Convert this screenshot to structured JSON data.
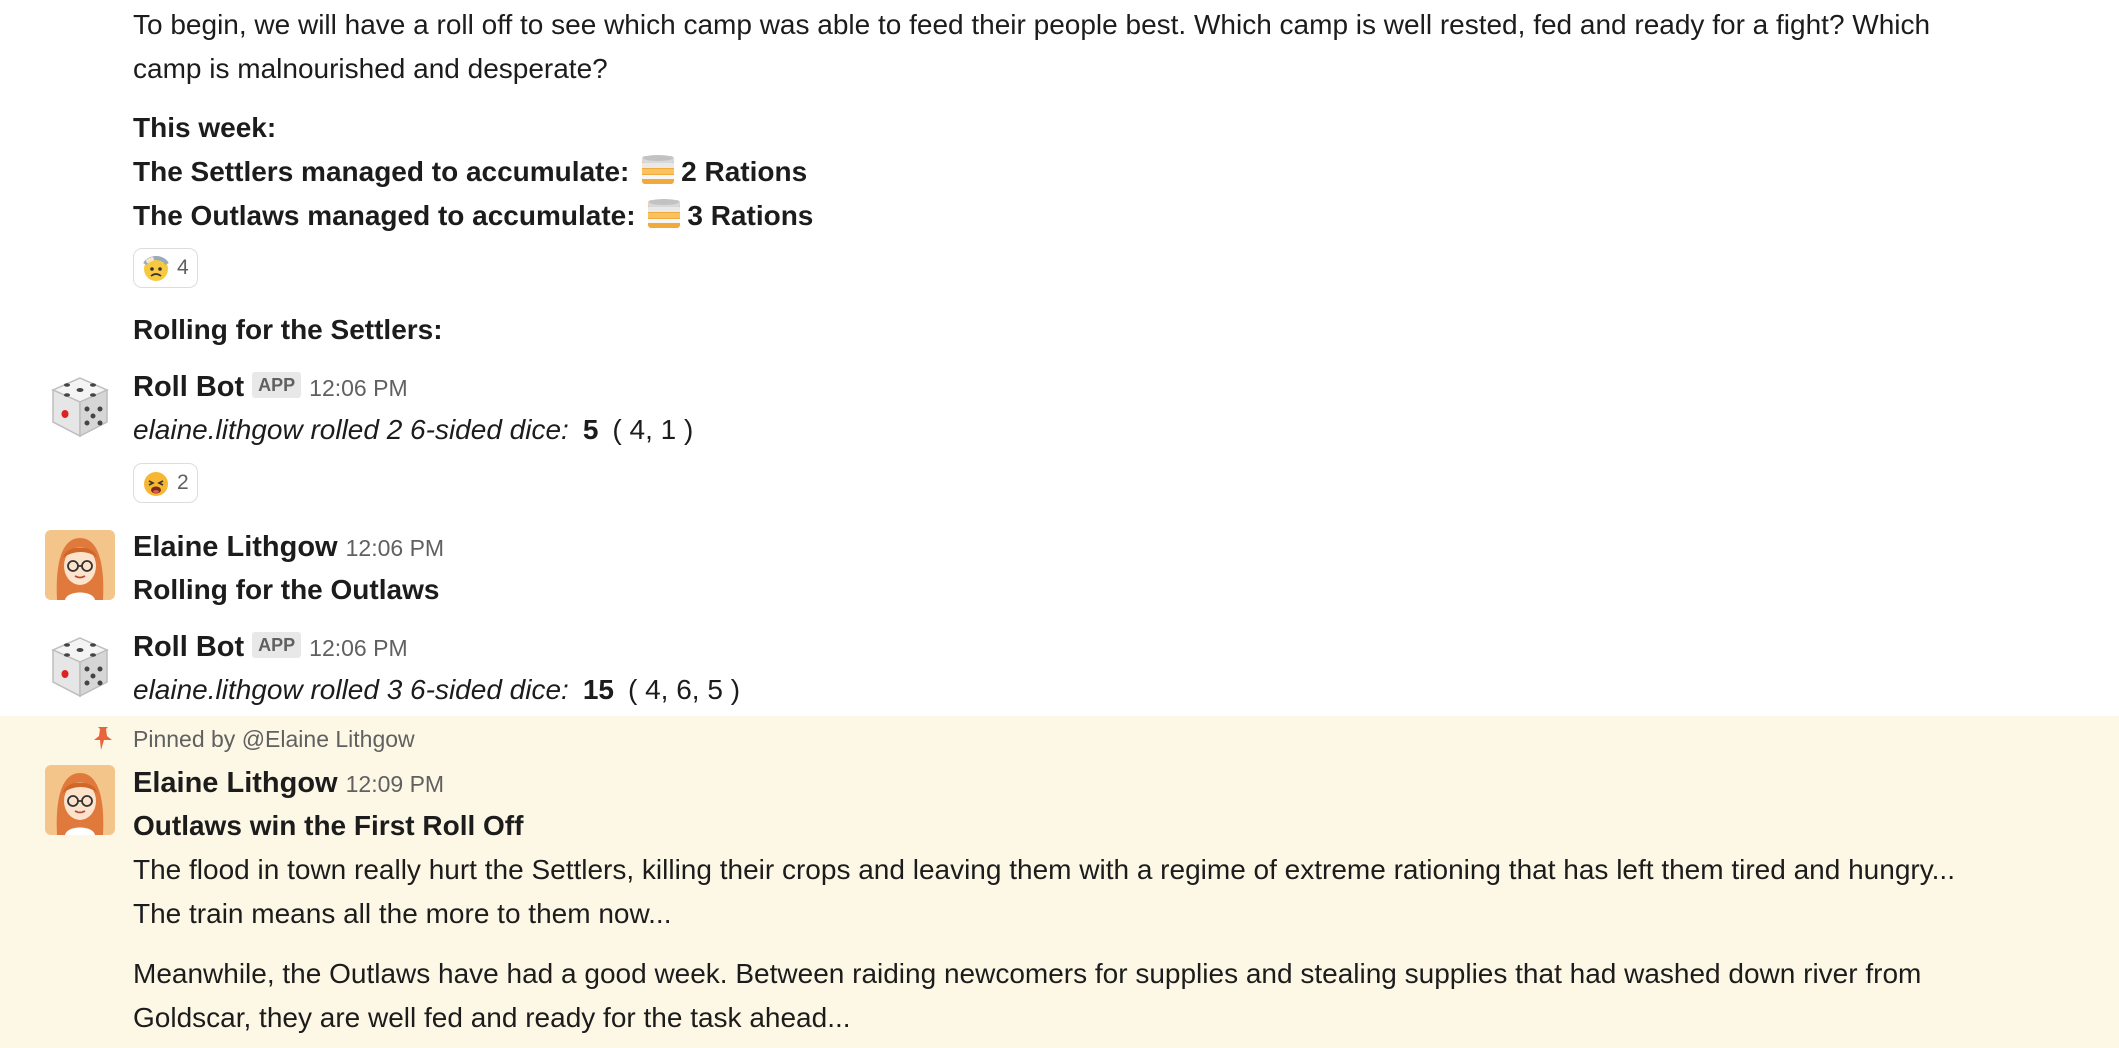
{
  "intro": {
    "line1": "To begin, we will have a roll off to see which camp was able to feed their people best. Which camp is well rested, fed and ready for a fight? Which",
    "line2": "camp is malnourished and desperate?"
  },
  "week": {
    "heading": "This week:",
    "settlers_prefix": "The Settlers managed to accumulate:",
    "settlers_rations": "2 Rations",
    "outlaws_prefix": "The Outlaws managed to accumulate:",
    "outlaws_rations": "3 Rations",
    "ration_icon": "canned-food-icon"
  },
  "reactions": {
    "first": {
      "icon": "face-with-bandage-icon",
      "count": "4"
    },
    "second": {
      "icon": "tired-face-icon",
      "count": "2"
    }
  },
  "rolling_settlers_label": "Rolling for the Settlers:",
  "messages": [
    {
      "author": "Roll Bot",
      "badge": "APP",
      "time": "12:06 PM",
      "avatar_icon": "dice-icon",
      "roll_text": "elaine.lithgow rolled 2 6-sided dice:",
      "roll_total": "5",
      "roll_values": "( 4,  1 )"
    },
    {
      "author": "Elaine Lithgow",
      "time": "12:06 PM",
      "avatar_icon": "user-avatar",
      "text": "Rolling for the Outlaws"
    },
    {
      "author": "Roll Bot",
      "badge": "APP",
      "time": "12:06 PM",
      "avatar_icon": "dice-icon",
      "roll_text": "elaine.lithgow rolled 3 6-sided dice:",
      "roll_total": "15",
      "roll_values": "( 4,  6,  5 )"
    }
  ],
  "pinned": {
    "label": "Pinned by",
    "pinned_by": "@Elaine Lithgow",
    "author": "Elaine Lithgow",
    "time": "12:09 PM",
    "title": "Outlaws win the First Roll Off",
    "para1_line1": "The flood in town really hurt the Settlers, killing their crops and leaving them with a regime of extreme rationing that has left them tired and hungry...",
    "para1_line2": "The train means all the more to them now...",
    "para2_line1": "Meanwhile, the Outlaws have had a good week. Between raiding newcomers for supplies and stealing supplies that had washed down river from",
    "para2_line2": "Goldscar, they are well fed and ready for the task ahead...",
    "background_color": "#fdf8e5",
    "pin_color": "#e8643c"
  }
}
